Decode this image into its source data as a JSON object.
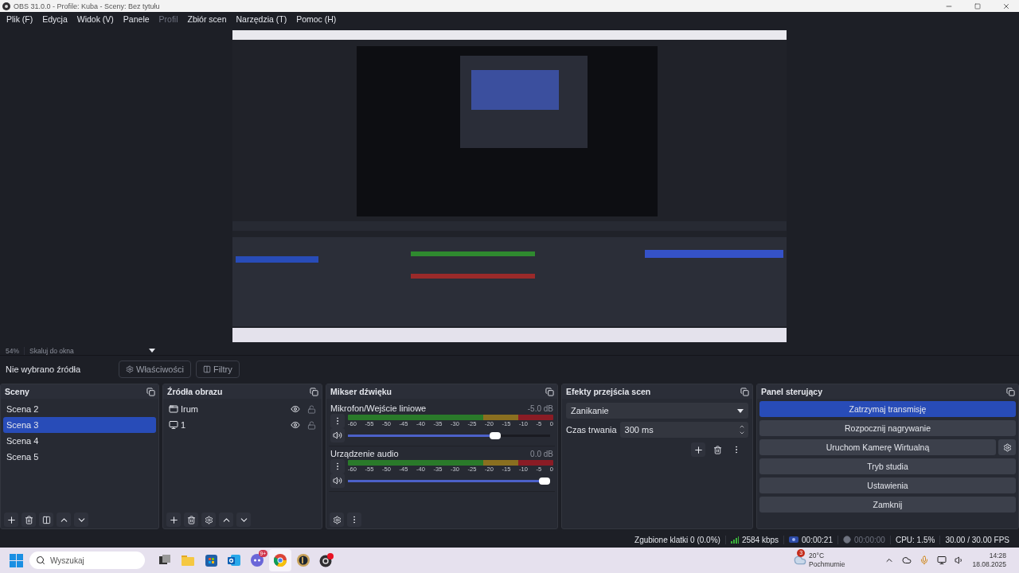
{
  "window": {
    "title": "OBS 31.0.0 - Profile: Kuba - Sceny: Bez tytułu"
  },
  "menu": [
    {
      "label": "Plik (F)",
      "disabled": false
    },
    {
      "label": "Edycja",
      "disabled": false
    },
    {
      "label": "Widok (V)",
      "disabled": false
    },
    {
      "label": "Panele",
      "disabled": false
    },
    {
      "label": "Profil",
      "disabled": true
    },
    {
      "label": "Zbiór scen",
      "disabled": false
    },
    {
      "label": "Narzędzia (T)",
      "disabled": false
    },
    {
      "label": "Pomoc (H)",
      "disabled": false
    }
  ],
  "zoom": {
    "percent": "54%",
    "mode": "Skaluj do okna"
  },
  "source_bar": {
    "label": "Nie wybrano źródła",
    "buttons": [
      {
        "label": "Właściwości",
        "kind": "properties"
      },
      {
        "label": "Filtry",
        "kind": "filters"
      }
    ]
  },
  "scenes": {
    "title": "Sceny",
    "items": [
      {
        "label": "Scena 2",
        "selected": false
      },
      {
        "label": "Scena 3",
        "selected": true
      },
      {
        "label": "Scena 4",
        "selected": false
      },
      {
        "label": "Scena 5",
        "selected": false
      }
    ]
  },
  "sources": {
    "title": "Źródła obrazu",
    "items": [
      {
        "label": "Irum",
        "kind": "window",
        "visible": true,
        "locked": false
      },
      {
        "label": "1",
        "kind": "display",
        "visible": true,
        "locked": false
      }
    ]
  },
  "mixer": {
    "title": "Mikser dźwięku",
    "channels": [
      {
        "name": "Mikrofon/Wejście liniowe",
        "reading": "-5.0 dB",
        "level": 0.74,
        "scale": [
          "-60",
          "-55",
          "-50",
          "-45",
          "-40",
          "-35",
          "-30",
          "-25",
          "-20",
          "-15",
          "-10",
          "-5",
          "0"
        ]
      },
      {
        "name": "Urządzenie audio",
        "reading": "0.0 dB",
        "level": 1.0,
        "scale": [
          "-60",
          "-55",
          "-50",
          "-45",
          "-40",
          "-35",
          "-30",
          "-25",
          "-20",
          "-15",
          "-10",
          "-5",
          "0"
        ]
      }
    ]
  },
  "transitions": {
    "title": "Efekty przejścia scen",
    "effect": "Zanikanie",
    "duration_label": "Czas trwania",
    "duration": "300 ms"
  },
  "controls": {
    "title": "Panel sterujący",
    "buttons": [
      {
        "label": "Zatrzymaj transmisję",
        "active": true,
        "settings": false
      },
      {
        "label": "Rozpocznij nagrywanie",
        "active": false,
        "settings": false
      },
      {
        "label": "Uruchom Kamerę Wirtualną",
        "active": false,
        "settings": true
      },
      {
        "label": "Tryb studia",
        "active": false,
        "settings": false
      },
      {
        "label": "Ustawienia",
        "active": false,
        "settings": false
      },
      {
        "label": "Zamknij",
        "active": false,
        "settings": false
      }
    ]
  },
  "status_bar": {
    "dropped": "Zgubione klatki 0 (0.0%)",
    "bitrate": "2584 kbps",
    "stream_time": "00:00:21",
    "record_time": "00:00:00",
    "cpu": "CPU: 1.5%",
    "fps": "30.00 / 30.00 FPS"
  },
  "taskbar": {
    "search": {
      "placeholder": "Wyszukaj"
    },
    "apps": [
      {
        "kind": "taskview",
        "active": false
      },
      {
        "kind": "folder",
        "active": false
      },
      {
        "kind": "store",
        "active": false
      },
      {
        "kind": "mail",
        "active": false
      },
      {
        "kind": "chat",
        "active": false,
        "badge": "9+"
      },
      {
        "kind": "browser",
        "active": true
      },
      {
        "kind": "game",
        "active": false
      },
      {
        "kind": "recorder",
        "active": false
      }
    ],
    "weather": {
      "badge": "3",
      "temperature": "20°C",
      "condition": "Pochmurnie"
    },
    "time": "14:28",
    "date": "18.08.2025"
  }
}
